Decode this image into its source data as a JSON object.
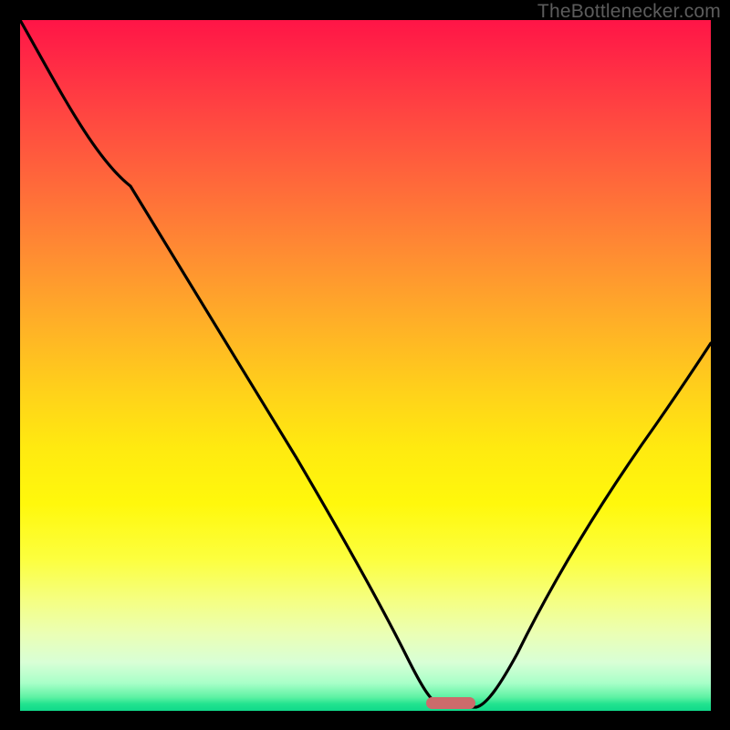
{
  "watermark": "TheBottlenecker.com",
  "chart_data": {
    "type": "line",
    "title": "",
    "xlabel": "",
    "ylabel": "",
    "xlim": [
      0,
      100
    ],
    "ylim": [
      0,
      100
    ],
    "marker": {
      "x_range": [
        59,
        66
      ],
      "y": 0
    },
    "series": [
      {
        "name": "bottleneck-curve",
        "x": [
          0,
          8,
          16,
          24,
          32,
          40,
          48,
          54,
          58,
          60,
          62,
          64,
          66,
          70,
          76,
          84,
          92,
          100
        ],
        "values": [
          100,
          88,
          76,
          62,
          49,
          36,
          24,
          14,
          6,
          1.5,
          0,
          0,
          0.5,
          4,
          13,
          27,
          42,
          57
        ]
      }
    ],
    "gradient_stops": [
      {
        "pos": 0,
        "color": "#ff1547"
      },
      {
        "pos": 14,
        "color": "#ff4741"
      },
      {
        "pos": 34,
        "color": "#ff8d32"
      },
      {
        "pos": 54,
        "color": "#ffd21a"
      },
      {
        "pos": 78,
        "color": "#fcff3e"
      },
      {
        "pos": 93,
        "color": "#d8ffd6"
      },
      {
        "pos": 100,
        "color": "#10d98a"
      }
    ]
  }
}
